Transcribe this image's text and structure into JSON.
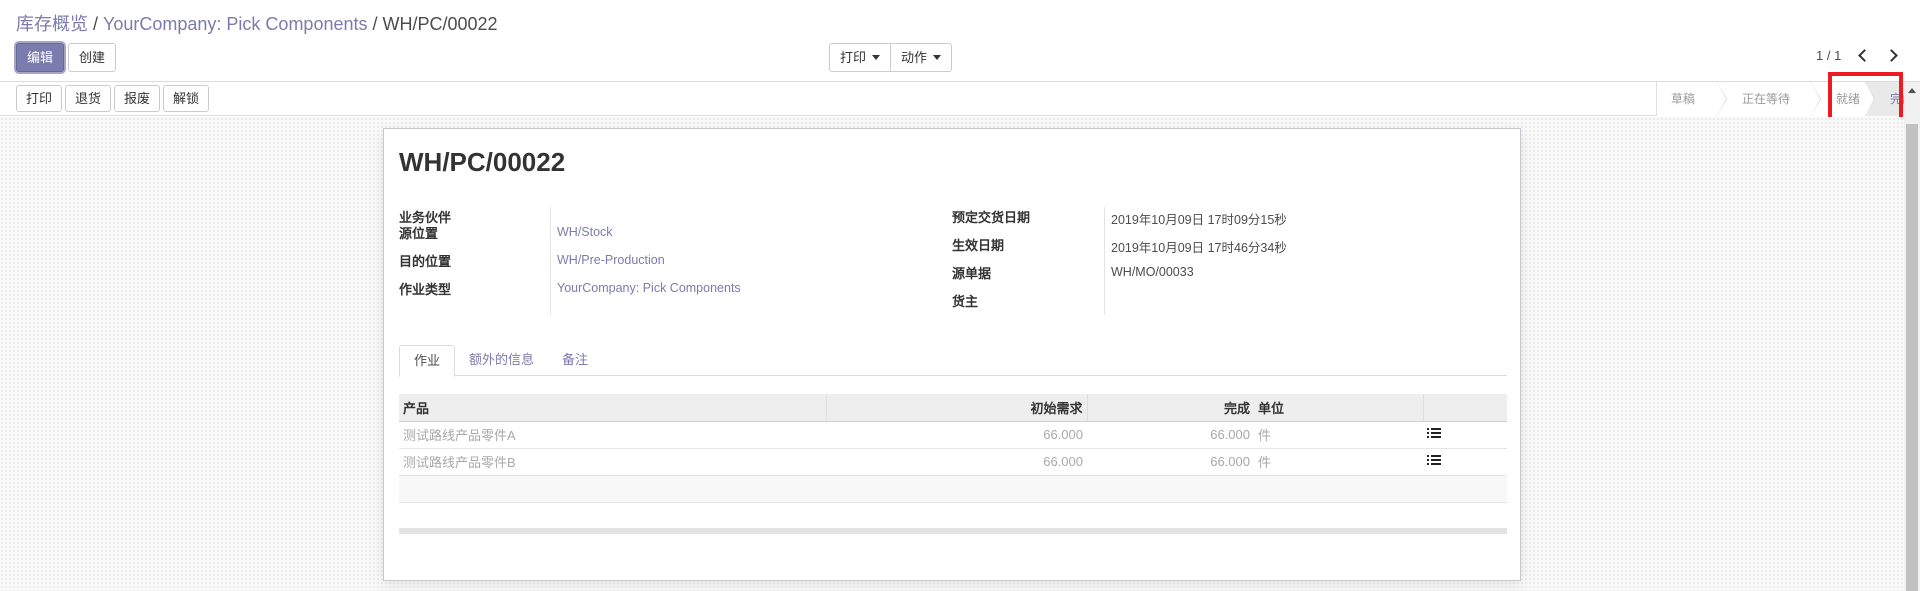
{
  "breadcrumb": {
    "items": [
      "库存概览",
      "YourCompany: Pick Components"
    ],
    "current": "WH/PC/00022",
    "separator": "/"
  },
  "toolbar": {
    "edit_label": "编辑",
    "create_label": "创建",
    "print_label": "打印",
    "action_label": "动作"
  },
  "pager": {
    "value": "1 / 1"
  },
  "actions": {
    "print": "打印",
    "return": "退货",
    "scrap": "报废",
    "unlock": "解锁"
  },
  "stages": {
    "draft": "草稿",
    "waiting": "正在等待",
    "ready": "就绪",
    "done": "完成",
    "current": "done"
  },
  "record": {
    "title": "WH/PC/00022",
    "fields_left": [
      {
        "label": "业务伙伴",
        "value": ""
      },
      {
        "label": "源位置",
        "value": "WH/Stock"
      },
      {
        "label": "目的位置",
        "value": "WH/Pre-Production"
      },
      {
        "label": "作业类型",
        "value": "YourCompany: Pick Components"
      }
    ],
    "fields_right": [
      {
        "label": "预定交货日期",
        "value": "2019年10月09日 17时09分15秒"
      },
      {
        "label": "生效日期",
        "value": "2019年10月09日 17时46分34秒"
      },
      {
        "label": "源单据",
        "value": "WH/MO/00033"
      },
      {
        "label": "货主",
        "value": ""
      }
    ]
  },
  "tabs": [
    {
      "label": "作业",
      "active": true
    },
    {
      "label": "额外的信息",
      "active": false
    },
    {
      "label": "备注",
      "active": false
    }
  ],
  "table": {
    "columns": [
      "产品",
      "初始需求",
      "完成",
      "单位"
    ],
    "rows": [
      {
        "product": "测试路线产品零件A",
        "initial_demand": "66.000",
        "done": "66.000",
        "unit": "件"
      },
      {
        "product": "测试路线产品零件B",
        "initial_demand": "66.000",
        "done": "66.000",
        "unit": "件"
      }
    ]
  },
  "colors": {
    "brand": "#7c7bad",
    "highlight": "#ed1c24"
  }
}
